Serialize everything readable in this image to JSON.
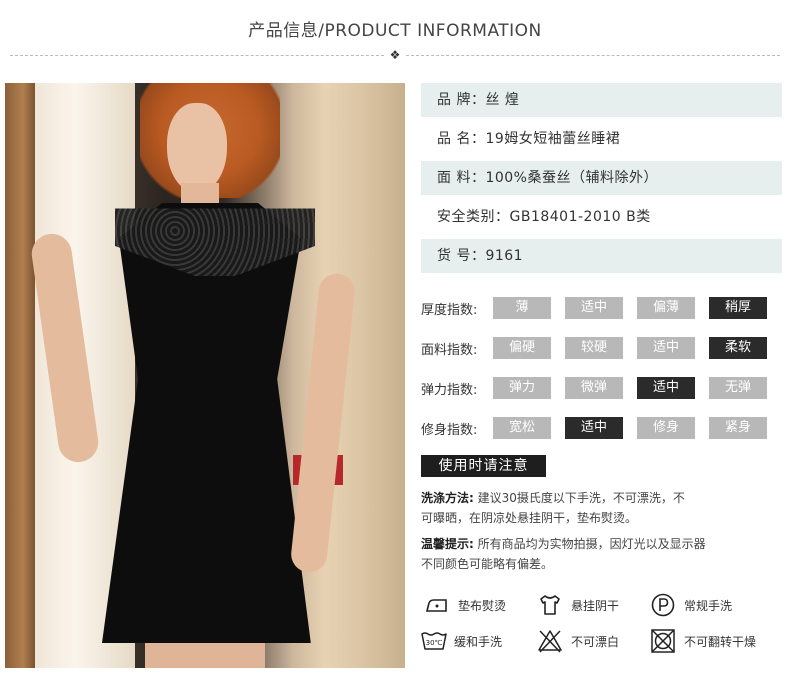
{
  "header": {
    "title": "产品信息/PRODUCT INFORMATION",
    "ornament": "❖"
  },
  "info": [
    {
      "text": "品 牌：丝 煌",
      "shaded": true
    },
    {
      "text": "品 名：19姆女短袖蕾丝睡裙",
      "shaded": false
    },
    {
      "text": "面 料：100%桑蚕丝（辅料除外）",
      "shaded": true
    },
    {
      "text": "安全类别：GB18401-2010 B类",
      "shaded": false
    },
    {
      "text": "货 号：9161",
      "shaded": true
    }
  ],
  "indices": [
    {
      "label": "厚度指数:",
      "options": [
        "薄",
        "适中",
        "偏薄",
        "稍厚"
      ],
      "selected": 3
    },
    {
      "label": "面料指数:",
      "options": [
        "偏硬",
        "较硬",
        "适中",
        "柔软"
      ],
      "selected": 3
    },
    {
      "label": "弹力指数:",
      "options": [
        "弹力",
        "微弹",
        "适中",
        "无弹"
      ],
      "selected": 2
    },
    {
      "label": "修身指数:",
      "options": [
        "宽松",
        "适中",
        "修身",
        "紧身"
      ],
      "selected": 1
    }
  ],
  "notice": {
    "title": "使用时请注意",
    "wash_label": "洗涤方法:",
    "wash_line1": "建议30摄氏度以下手洗，不可漂洗，不",
    "wash_line2": "可曝晒，在阴凉处悬挂阴干，垫布熨烫。",
    "tip_label": "温馨提示:",
    "tip_line1": "所有商品均为实物拍摄，因灯光以及显示器",
    "tip_line2": "不同颜色可能略有偏差。"
  },
  "care": [
    {
      "icon": "iron-icon",
      "label": "垫布熨烫"
    },
    {
      "icon": "hang-dry-icon",
      "label": "悬挂阴干"
    },
    {
      "icon": "dry-clean-p-icon",
      "label": "常规手洗"
    },
    {
      "icon": "hand-wash-icon",
      "label": "缓和手洗",
      "icon_text": "30℃"
    },
    {
      "icon": "no-bleach-icon",
      "label": "不可漂白"
    },
    {
      "icon": "no-tumble-dry-icon",
      "label": "不可翻转干燥"
    }
  ]
}
